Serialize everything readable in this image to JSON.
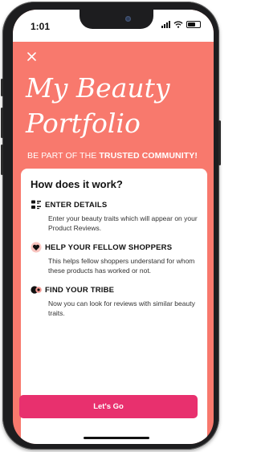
{
  "status_bar": {
    "time": "1:01"
  },
  "header": {
    "close_icon": "close-icon",
    "title": "My Beauty Portfolio",
    "tagline_prefix": "BE PART OF THE ",
    "tagline_bold": "TRUSTED COMMUNITY!"
  },
  "card": {
    "heading": "How does it work?",
    "steps": [
      {
        "icon": "details-list-icon",
        "title": "ENTER DETAILS",
        "description": "Enter your beauty traits which will appear on your Product Reviews."
      },
      {
        "icon": "heart-hand-icon",
        "title": "HELP YOUR FELLOW SHOPPERS",
        "description": "This helps fellow shoppers understand for whom these products has worked or not."
      },
      {
        "icon": "tribe-icon",
        "title": "FIND YOUR TRIBE",
        "description": "Now you can look for reviews with similar beauty traits."
      }
    ],
    "cta_label": "Let's Go"
  },
  "colors": {
    "header_bg": "#f8796d",
    "cta_bg": "#e8306e",
    "icon_accent": "#f39a94"
  }
}
